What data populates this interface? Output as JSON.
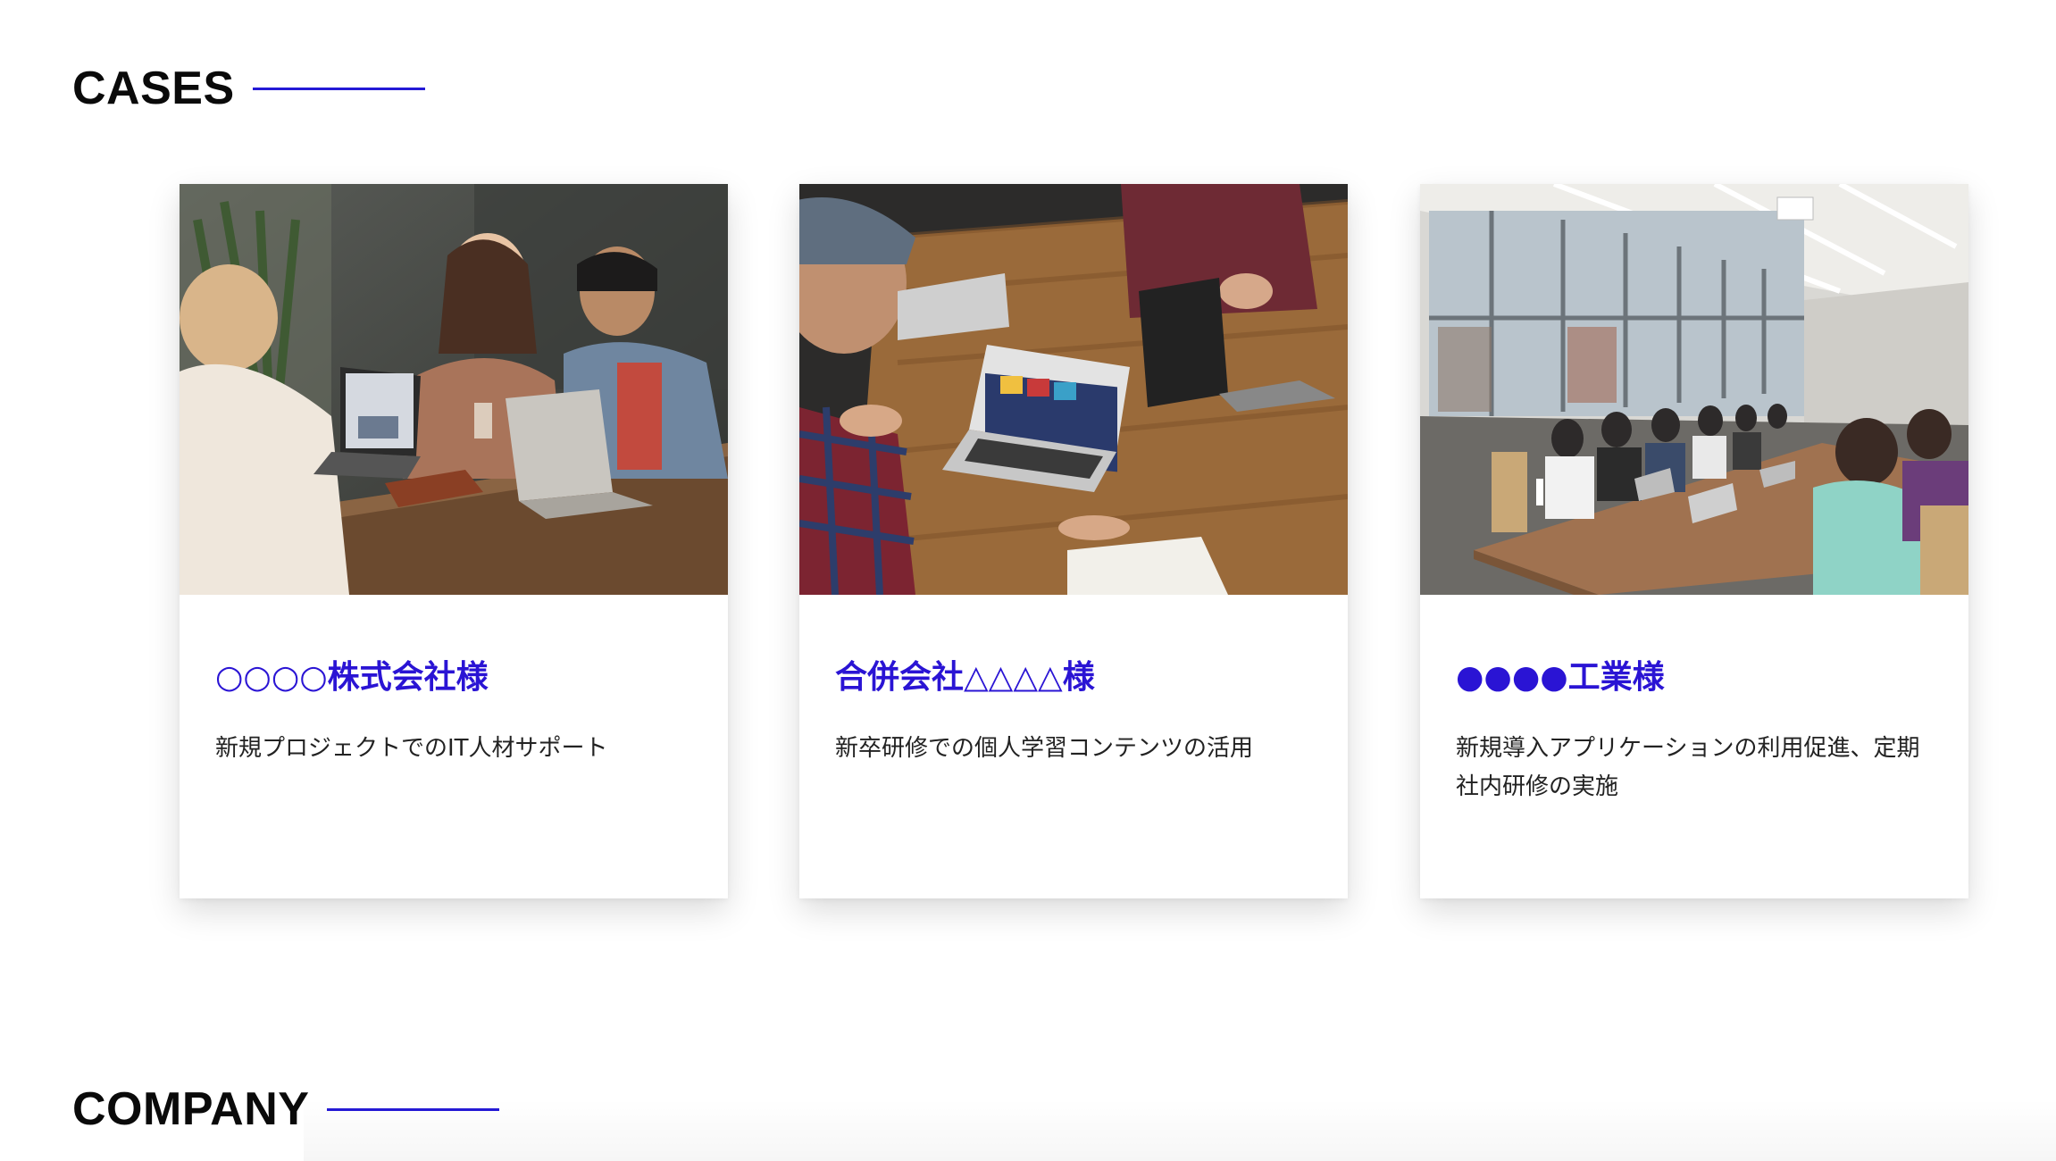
{
  "sections": {
    "cases": {
      "title": "CASES"
    },
    "company": {
      "title": "COMPANY"
    }
  },
  "accent_color": "#2a14d4",
  "cases": [
    {
      "title": "○○○○株式会社様",
      "description": "新規プロジェクトでのIT人材サポート",
      "photo": "three-people-laughing-at-cafe-table-with-laptops"
    },
    {
      "title": "合併会社△△△△様",
      "description": "新卒研修での個人学習コンテンツの活用",
      "photo": "people-discussing-around-wooden-table-with-macbooks"
    },
    {
      "title": "●●●●工業様",
      "description": "新規導入アプリケーションの利用促進、定期社内研修の実施",
      "photo": "large-team-meeting-at-long-conference-table"
    }
  ]
}
